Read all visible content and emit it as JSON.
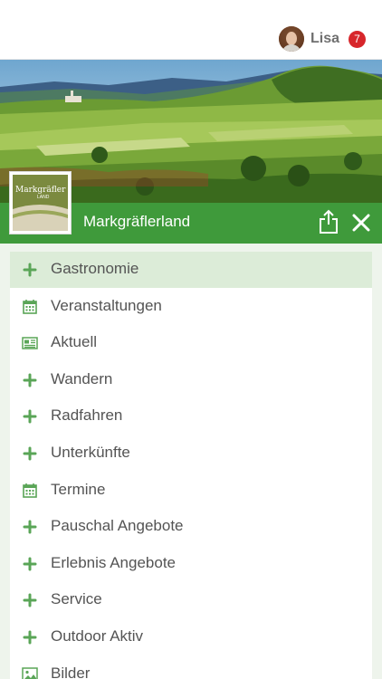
{
  "user": {
    "name": "Lisa",
    "notification_count": "7"
  },
  "header": {
    "title": "Markgräflerland"
  },
  "logo": {
    "word": "Markgräfler",
    "sub": "LAND"
  },
  "colors": {
    "brand_green": "#3f9a3b",
    "badge_red": "#d7262b",
    "active_row": "#dcecd8",
    "icon_green": "#5aa557"
  },
  "menu": {
    "items": [
      {
        "label": "Gastronomie",
        "icon": "plus-icon",
        "active": true
      },
      {
        "label": "Veranstaltungen",
        "icon": "calendar-icon"
      },
      {
        "label": "Aktuell",
        "icon": "newspaper-icon"
      },
      {
        "label": "Wandern",
        "icon": "plus-icon"
      },
      {
        "label": "Radfahren",
        "icon": "plus-icon"
      },
      {
        "label": "Unterkünfte",
        "icon": "plus-icon"
      },
      {
        "label": "Termine",
        "icon": "calendar-icon"
      },
      {
        "label": "Pauschal Angebote",
        "icon": "plus-icon"
      },
      {
        "label": "Erlebnis Angebote",
        "icon": "plus-icon"
      },
      {
        "label": "Service",
        "icon": "plus-icon"
      },
      {
        "label": "Outdoor Aktiv",
        "icon": "plus-icon"
      },
      {
        "label": "Bilder",
        "icon": "image-icon"
      }
    ]
  }
}
